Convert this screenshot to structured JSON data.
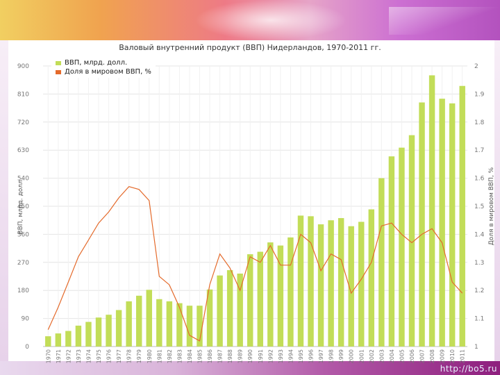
{
  "site_url": "http://bo5.ru",
  "chart_data": {
    "type": "bar",
    "title": "Валовый внутренний продукт (ВВП) Нидерландов, 1970-2011 гг.",
    "ylabel": "ВВП, млрд. долл.",
    "y2label": "Доля в мировом ВВП, %",
    "ylim": [
      0,
      900
    ],
    "y2lim": [
      1,
      2
    ],
    "yticks": [
      0,
      90,
      180,
      270,
      360,
      450,
      540,
      630,
      720,
      810,
      900
    ],
    "y2ticks": [
      "1",
      "1.1",
      "1.2",
      "1.3",
      "1.4",
      "1.5",
      "1.6",
      "1.7",
      "1.8",
      "1.9",
      "2"
    ],
    "categories": [
      "1970",
      "1971",
      "1972",
      "1973",
      "1974",
      "1975",
      "1976",
      "1977",
      "1978",
      "1979",
      "1980",
      "1981",
      "1982",
      "1983",
      "1984",
      "1985",
      "1986",
      "1987",
      "1988",
      "1989",
      "1990",
      "1991",
      "1992",
      "1993",
      "1994",
      "1995",
      "1996",
      "1997",
      "1998",
      "1999",
      "2000",
      "2001",
      "2002",
      "2003",
      "2004",
      "2005",
      "2006",
      "2007",
      "2008",
      "2009",
      "2010",
      "2011"
    ],
    "grid": true,
    "legend_position": "top-left",
    "series": [
      {
        "name": "ВВП, млрд. долл.",
        "kind": "bar",
        "color": "#c2dd58",
        "values": [
          33,
          42,
          50,
          67,
          79,
          93,
          102,
          117,
          145,
          163,
          182,
          152,
          145,
          139,
          131,
          131,
          183,
          228,
          245,
          234,
          296,
          304,
          334,
          324,
          350,
          420,
          418,
          392,
          405,
          412,
          386,
          400,
          440,
          540,
          610,
          638,
          678,
          783,
          870,
          795,
          780,
          836
        ]
      },
      {
        "name": "Доля в мировом ВВП, %",
        "kind": "line",
        "axis": "right",
        "color": "#e46a2b",
        "values": [
          1.06,
          1.14,
          1.23,
          1.32,
          1.38,
          1.44,
          1.48,
          1.53,
          1.57,
          1.56,
          1.52,
          1.25,
          1.22,
          1.14,
          1.04,
          1.02,
          1.22,
          1.33,
          1.28,
          1.2,
          1.32,
          1.3,
          1.36,
          1.29,
          1.29,
          1.4,
          1.37,
          1.27,
          1.33,
          1.31,
          1.19,
          1.24,
          1.3,
          1.43,
          1.44,
          1.4,
          1.37,
          1.4,
          1.42,
          1.37,
          1.23,
          1.19
        ]
      }
    ]
  }
}
